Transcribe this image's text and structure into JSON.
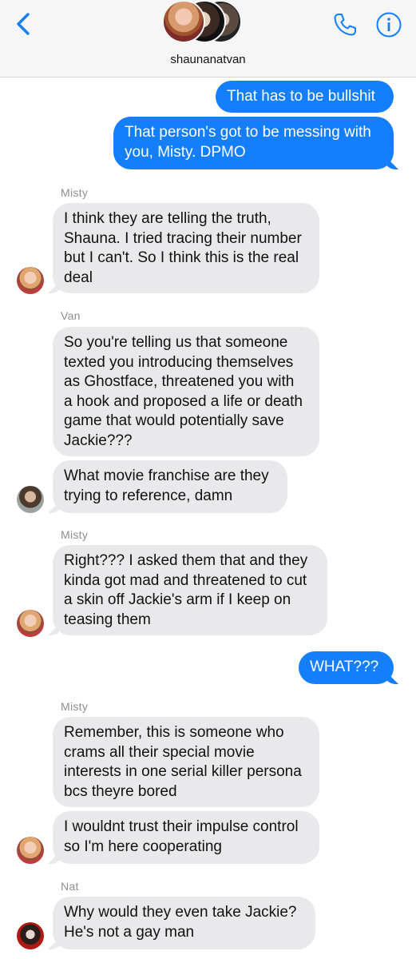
{
  "header": {
    "conversation_name": "shaunanatvan",
    "back_icon": "chevron-left-icon",
    "phone_icon": "phone-icon",
    "info_icon": "info-icon",
    "accent_color": "#147efb"
  },
  "messages": [
    {
      "direction": "outgoing",
      "text": "That has to be bullshit"
    },
    {
      "direction": "outgoing",
      "text": "That person's got to be messing with\nyou, Misty. DPMO"
    },
    {
      "direction": "incoming",
      "sender": "Misty",
      "text": "I think they are telling the truth,\nShauna. I tried tracing their number\nbut I can't. So I think this is the real\ndeal"
    },
    {
      "direction": "incoming",
      "sender": "Van",
      "text": "So you're telling us that someone\ntexted you introducing themselves\nas Ghostface, threatened you with\na hook and proposed a life or death\ngame that would potentially save\nJackie???"
    },
    {
      "direction": "incoming",
      "text": "What movie franchise are they\ntrying to reference, damn"
    },
    {
      "direction": "incoming",
      "sender": "Misty",
      "text": "Right??? I asked them that and they\nkinda got mad and threatened to cut\na skin off Jackie's arm if I keep on\nteasing them"
    },
    {
      "direction": "outgoing",
      "text": "WHAT???"
    },
    {
      "direction": "incoming",
      "sender": "Misty",
      "text": "Remember, this is someone who\ncrams all their special movie\ninterests in one serial killer persona\nbcs theyre bored"
    },
    {
      "direction": "incoming",
      "text": "I wouldnt trust their impulse control\nso I'm here cooperating"
    },
    {
      "direction": "incoming",
      "sender": "Nat",
      "text": "Why would they even take Jackie?\nHe's not a gay man"
    }
  ]
}
